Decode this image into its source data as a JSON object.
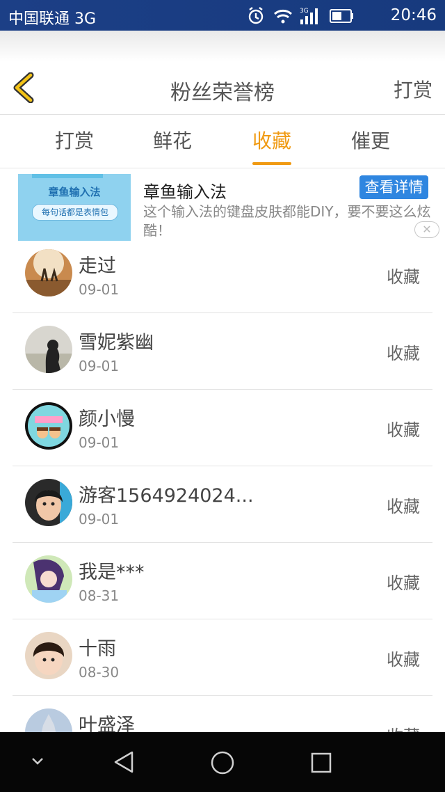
{
  "status": {
    "carrier": "中国联通 3G",
    "time": "20:46",
    "network": "3G"
  },
  "header": {
    "title": "粉丝荣誉榜",
    "right_action": "打赏"
  },
  "tabs": [
    {
      "label": "打赏",
      "active": false
    },
    {
      "label": "鲜花",
      "active": false
    },
    {
      "label": "收藏",
      "active": true
    },
    {
      "label": "催更",
      "active": false
    }
  ],
  "ad": {
    "image_title": "章鱼输入法",
    "image_tagline": "每句话都是表情包",
    "title": "章鱼输入法",
    "button": "查看详情",
    "description": "这个输入法的键盘皮肤都能DIY，要不要这么炫酷！",
    "close_symbol": "✕"
  },
  "fans": [
    {
      "name": "走过",
      "date": "09-01",
      "action": "收藏"
    },
    {
      "name": "雪妮紫幽",
      "date": "09-01",
      "action": "收藏"
    },
    {
      "name": "颜小慢",
      "date": "09-01",
      "action": "收藏"
    },
    {
      "name": "游客1564924024...",
      "date": "09-01",
      "action": "收藏"
    },
    {
      "name": "我是***",
      "date": "08-31",
      "action": "收藏"
    },
    {
      "name": "十雨",
      "date": "08-30",
      "action": "收藏"
    },
    {
      "name": "叶盛泽",
      "date": "",
      "action": "收藏"
    }
  ],
  "colors": {
    "accent": "#f09a12",
    "status_bar": "#1c3f86",
    "ad_button": "#2f86e0"
  }
}
